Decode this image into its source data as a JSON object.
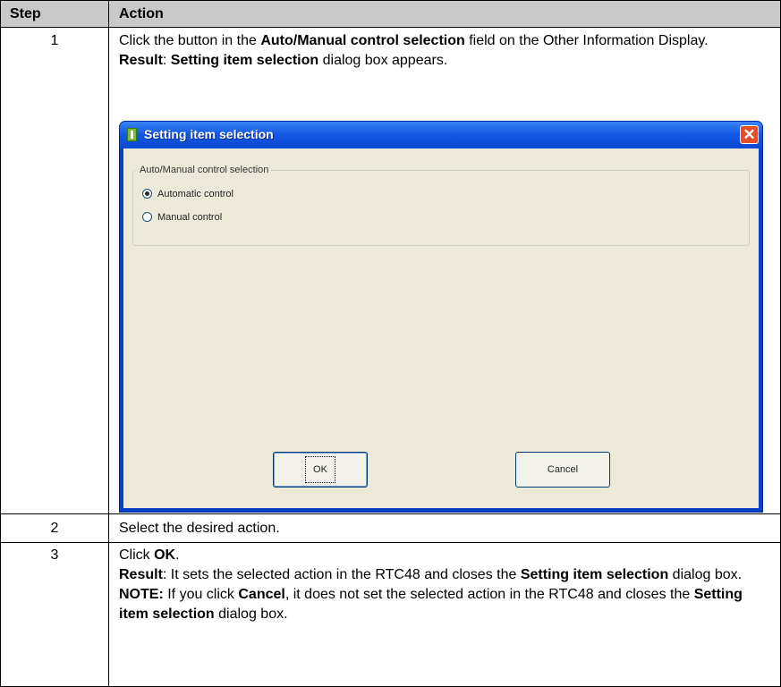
{
  "table": {
    "header": {
      "step": "Step",
      "action": "Action"
    },
    "rows": [
      {
        "step": "1",
        "line1": "Click the button in the ",
        "line1_bold": "Auto/Manual control selection",
        "line1_tail": " field on the Other Information Display.",
        "result_label": "Result",
        "result_colon": ": ",
        "result_bold": "Setting item selection",
        "result_tail": " dialog box appears."
      },
      {
        "step": "2",
        "text": "Select the desired action."
      },
      {
        "step": "3",
        "line1": "Click ",
        "line1_bold": "OK",
        "line1_tail": ".",
        "result_label": "Result",
        "result_text": ": It sets the selected action in the RTC48 and closes the ",
        "result_bold": "Setting item selection",
        "result_tail": " dialog box.",
        "note_label": "NOTE:",
        "note_text1": " If you click ",
        "note_bold": "Cancel",
        "note_text2": ", it does not set the selected action in the RTC48 and closes the ",
        "note_bold2": "Setting item selection",
        "note_tail": " dialog box."
      }
    ]
  },
  "dialog": {
    "title": "Setting item selection",
    "group_label": "Auto/Manual control selection",
    "options": [
      {
        "label": "Automatic control",
        "selected": true
      },
      {
        "label": "Manual control",
        "selected": false
      }
    ],
    "ok_label": "OK",
    "cancel_label": "Cancel",
    "close_glyph": "✕"
  }
}
